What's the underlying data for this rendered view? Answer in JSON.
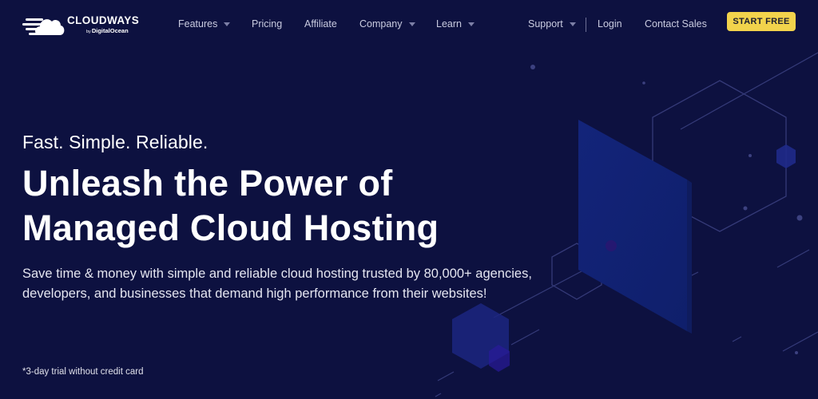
{
  "brand": {
    "name": "CLOUDWAYS",
    "by": "by",
    "parent": "DigitalOcean",
    "accent_color": "#f2d34c",
    "background_color": "#0d1140"
  },
  "nav": {
    "items": [
      {
        "label": "Features",
        "has_dropdown": true
      },
      {
        "label": "Pricing",
        "has_dropdown": false
      },
      {
        "label": "Affiliate",
        "has_dropdown": false
      },
      {
        "label": "Company",
        "has_dropdown": true
      },
      {
        "label": "Learn",
        "has_dropdown": true
      }
    ],
    "right": [
      {
        "label": "Support",
        "has_dropdown": true
      },
      {
        "label": "Login",
        "has_dropdown": false
      },
      {
        "label": "Contact Sales",
        "has_dropdown": false
      }
    ],
    "cta_label": "START FREE"
  },
  "hero": {
    "tagline": "Fast. Simple. Reliable.",
    "headline_line1": "Unleash the Power of",
    "headline_line2": "Managed Cloud Hosting",
    "description": "Save time & money with simple and reliable cloud hosting trusted by 80,000+ agencies, developers, and businesses that demand high performance from their websites!",
    "footnote": "*3-day trial without credit card"
  }
}
